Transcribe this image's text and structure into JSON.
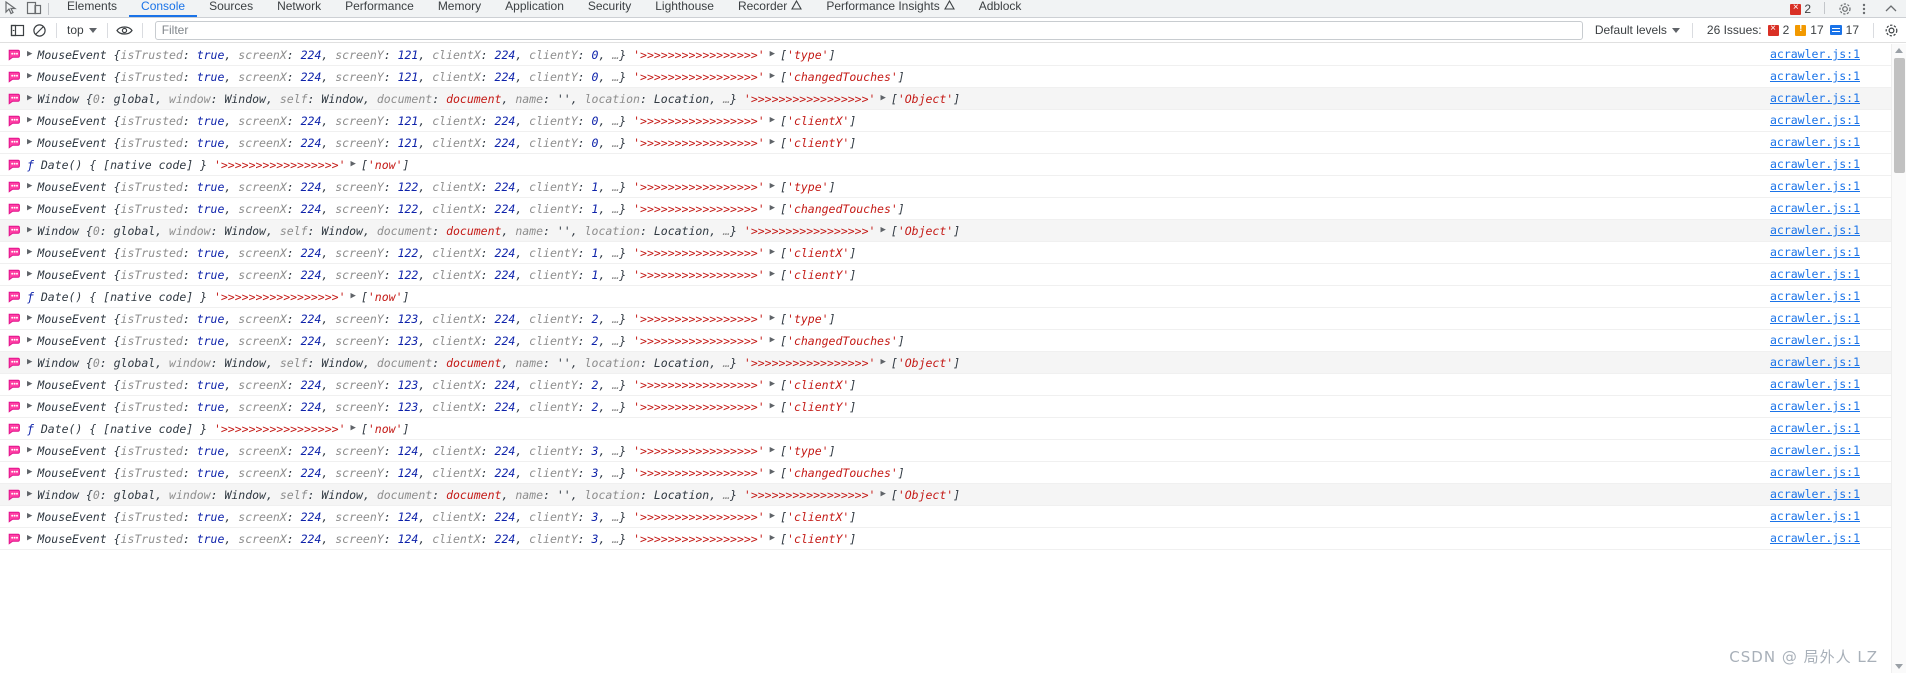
{
  "window": {
    "title": "Chrome DevTools - Console"
  },
  "tabstrip": {
    "inspect_icon": "inspect-element-icon",
    "device_icon": "device-toolbar-icon",
    "tabs": [
      {
        "label": "Elements",
        "active": false,
        "warn": false
      },
      {
        "label": "Console",
        "active": true,
        "warn": false
      },
      {
        "label": "Sources",
        "active": false,
        "warn": false
      },
      {
        "label": "Network",
        "active": false,
        "warn": false
      },
      {
        "label": "Performance",
        "active": false,
        "warn": false
      },
      {
        "label": "Memory",
        "active": false,
        "warn": false
      },
      {
        "label": "Application",
        "active": false,
        "warn": false
      },
      {
        "label": "Security",
        "active": false,
        "warn": false
      },
      {
        "label": "Lighthouse",
        "active": false,
        "warn": false
      },
      {
        "label": "Recorder",
        "active": false,
        "warn": true
      },
      {
        "label": "Performance Insights",
        "active": false,
        "warn": true
      },
      {
        "label": "Adblock",
        "active": false,
        "warn": false
      }
    ],
    "error_count": "2",
    "settings_icon": "gear-icon",
    "more_icon": "more-vertical-icon",
    "close_icon": "close-devtools-icon"
  },
  "toolbar": {
    "sidebar_toggle_icon": "console-sidebar-icon",
    "clear_icon": "clear-console-icon",
    "context": "top",
    "eye_icon": "live-expression-icon",
    "filter_placeholder": "Filter",
    "filter_value": "",
    "levels_label": "Default levels",
    "issues_label": "26 Issues:",
    "issues_error_count": "2",
    "issues_warn_count": "17",
    "issues_info_count": "17",
    "settings_icon": "console-settings-gear-icon"
  },
  "colors": {
    "accent": "#1a73e8",
    "error": "#d93025",
    "warning": "#f29900",
    "string": "#c41a16",
    "number": "#0d22aa"
  },
  "console": {
    "source_link": "acrawler.js:1",
    "arrow_string": "'>>>>>>>>>>>>>>>>>'",
    "watermark": "CSDN @ 局外人 LZ",
    "rows": [
      {
        "kind": "event",
        "ctor": "MouseEvent",
        "screenY": "121",
        "clientY": "0",
        "screenX": "224",
        "clientX": "224",
        "prop": "'type'",
        "shaded": false
      },
      {
        "kind": "event",
        "ctor": "MouseEvent",
        "screenY": "121",
        "clientY": "0",
        "screenX": "224",
        "clientX": "224",
        "prop": "'changedTouches'",
        "shaded": false
      },
      {
        "kind": "window",
        "ctor": "Window",
        "prop": "'Object'",
        "shaded": true
      },
      {
        "kind": "event",
        "ctor": "MouseEvent",
        "screenY": "121",
        "clientY": "0",
        "screenX": "224",
        "clientX": "224",
        "prop": "'clientX'",
        "shaded": false
      },
      {
        "kind": "event",
        "ctor": "MouseEvent",
        "screenY": "121",
        "clientY": "0",
        "screenX": "224",
        "clientX": "224",
        "prop": "'clientY'",
        "shaded": false
      },
      {
        "kind": "date",
        "prop": "'now'",
        "shaded": false
      },
      {
        "kind": "event",
        "ctor": "MouseEvent",
        "screenY": "122",
        "clientY": "1",
        "screenX": "224",
        "clientX": "224",
        "prop": "'type'",
        "shaded": false
      },
      {
        "kind": "event",
        "ctor": "MouseEvent",
        "screenY": "122",
        "clientY": "1",
        "screenX": "224",
        "clientX": "224",
        "prop": "'changedTouches'",
        "shaded": false
      },
      {
        "kind": "window",
        "ctor": "Window",
        "prop": "'Object'",
        "shaded": true
      },
      {
        "kind": "event",
        "ctor": "MouseEvent",
        "screenY": "122",
        "clientY": "1",
        "screenX": "224",
        "clientX": "224",
        "prop": "'clientX'",
        "shaded": false
      },
      {
        "kind": "event",
        "ctor": "MouseEvent",
        "screenY": "122",
        "clientY": "1",
        "screenX": "224",
        "clientX": "224",
        "prop": "'clientY'",
        "shaded": false
      },
      {
        "kind": "date",
        "prop": "'now'",
        "shaded": false
      },
      {
        "kind": "event",
        "ctor": "MouseEvent",
        "screenY": "123",
        "clientY": "2",
        "screenX": "224",
        "clientX": "224",
        "prop": "'type'",
        "shaded": false
      },
      {
        "kind": "event",
        "ctor": "MouseEvent",
        "screenY": "123",
        "clientY": "2",
        "screenX": "224",
        "clientX": "224",
        "prop": "'changedTouches'",
        "shaded": false
      },
      {
        "kind": "window",
        "ctor": "Window",
        "prop": "'Object'",
        "shaded": true
      },
      {
        "kind": "event",
        "ctor": "MouseEvent",
        "screenY": "123",
        "clientY": "2",
        "screenX": "224",
        "clientX": "224",
        "prop": "'clientX'",
        "shaded": false
      },
      {
        "kind": "event",
        "ctor": "MouseEvent",
        "screenY": "123",
        "clientY": "2",
        "screenX": "224",
        "clientX": "224",
        "prop": "'clientY'",
        "shaded": false
      },
      {
        "kind": "date",
        "prop": "'now'",
        "shaded": false
      },
      {
        "kind": "event",
        "ctor": "MouseEvent",
        "screenY": "124",
        "clientY": "3",
        "screenX": "224",
        "clientX": "224",
        "prop": "'type'",
        "shaded": false
      },
      {
        "kind": "event",
        "ctor": "MouseEvent",
        "screenY": "124",
        "clientY": "3",
        "screenX": "224",
        "clientX": "224",
        "prop": "'changedTouches'",
        "shaded": false
      },
      {
        "kind": "window",
        "ctor": "Window",
        "prop": "'Object'",
        "shaded": true
      },
      {
        "kind": "event",
        "ctor": "MouseEvent",
        "screenY": "124",
        "clientY": "3",
        "screenX": "224",
        "clientX": "224",
        "prop": "'clientX'",
        "shaded": false
      },
      {
        "kind": "event",
        "ctor": "MouseEvent",
        "screenY": "124",
        "clientY": "3",
        "screenX": "224",
        "clientX": "224",
        "prop": "'clientY'",
        "shaded": false
      }
    ],
    "event_props": {
      "isTrusted_key": "isTrusted",
      "isTrusted_val": "true",
      "screenX_key": "screenX",
      "screenY_key": "screenY",
      "clientX_key": "clientX",
      "clientY_key": "clientY",
      "ellipsis": "…"
    },
    "window_props": {
      "i0_key": "0",
      "i0_val": "global",
      "window_key": "window",
      "window_val": "Window",
      "self_key": "self",
      "self_val": "Window",
      "document_key": "document",
      "document_val": "document",
      "name_key": "name",
      "name_val": "''",
      "location_key": "location",
      "location_val": "Location",
      "ellipsis": "…"
    },
    "date_text": {
      "fn": "ƒ",
      "name": "Date()",
      "body": "{ [native code] }"
    }
  }
}
